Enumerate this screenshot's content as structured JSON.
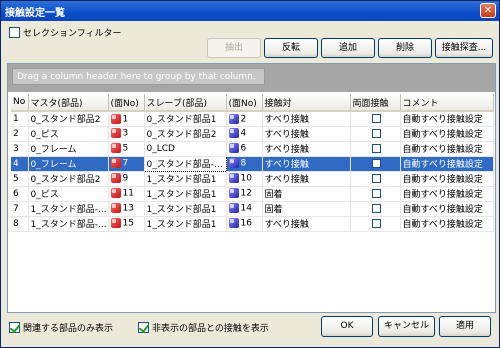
{
  "window": {
    "title": "接触設定一覧",
    "close": "✕"
  },
  "filter": {
    "label": "セレクションフィルター",
    "checked": false
  },
  "toolbar": {
    "extract": "抽出",
    "reverse": "反転",
    "add": "追加",
    "delete": "削除",
    "contact_search": "接触探査..."
  },
  "group_hint": "Drag a column header here to group by that column.",
  "columns": [
    "No",
    "マスタ(部品)",
    "(面No)",
    "スレーブ(部品)",
    "(面No)",
    "接触対",
    "両面接触",
    "コメント"
  ],
  "rows": [
    {
      "no": "1",
      "master": "0_スタンド部品2",
      "m_face": "1",
      "m_icon": "red",
      "slave": "0_スタンド部品1",
      "s_face": "2",
      "s_icon": "blue",
      "pair": "すべり接触",
      "both": false,
      "comment": "自動すべり接触設定"
    },
    {
      "no": "2",
      "master": "0_ピス",
      "m_face": "3",
      "m_icon": "red",
      "slave": "0_スタンド部品2",
      "s_face": "4",
      "s_icon": "blue",
      "pair": "すべり接触",
      "both": false,
      "comment": "自動すべり接触設定"
    },
    {
      "no": "3",
      "master": "0_フレーム",
      "m_face": "5",
      "m_icon": "red",
      "slave": "0_LCD",
      "s_face": "6",
      "s_icon": "blue",
      "pair": "すべり接触",
      "both": false,
      "comment": "自動すべり接触設定"
    },
    {
      "no": "4",
      "master": "0_フレーム",
      "m_face": "7",
      "m_icon": "red",
      "slave": "0_スタンド部品-...",
      "s_face": "8",
      "s_icon": "blue",
      "pair": "すべり接触",
      "both": false,
      "comment": "自動すべり接触設定",
      "selected": true
    },
    {
      "no": "5",
      "master": "0_スタンド部品2",
      "m_face": "9",
      "m_icon": "red",
      "slave": "1_スタンド部品1",
      "s_face": "10",
      "s_icon": "blue",
      "pair": "すべり接触",
      "both": false,
      "comment": "自動すべり接触設定"
    },
    {
      "no": "6",
      "master": "0_ピス",
      "m_face": "11",
      "m_icon": "red",
      "slave": "1_スタンド部品1",
      "s_face": "12",
      "s_icon": "blue",
      "pair": "固着",
      "both": false,
      "comment": "自動すべり接触設定"
    },
    {
      "no": "7",
      "master": "1_スタンド部品-...",
      "m_face": "13",
      "m_icon": "red",
      "slave": "1_スタンド部品1",
      "s_face": "14",
      "s_icon": "blue",
      "pair": "固着",
      "both": false,
      "comment": "自動すべり接触設定"
    },
    {
      "no": "8",
      "master": "1_スタンド部品-...",
      "m_face": "15",
      "m_icon": "red",
      "slave": "1_スタンド部品1",
      "s_face": "16",
      "s_icon": "blue",
      "pair": "すべり接触",
      "both": false,
      "comment": "自動すべり接触設定"
    }
  ],
  "bottom": {
    "only_related": "関連する部品のみ表示",
    "only_related_checked": true,
    "show_hidden": "非表示の部品との接触を表示",
    "show_hidden_checked": true,
    "ok": "OK",
    "cancel": "キャンセル",
    "apply": "適用"
  },
  "colors": {
    "selection": "#316ac5",
    "title_bar": "#0b4fcb",
    "dialog_bg": "#ece9d8"
  }
}
